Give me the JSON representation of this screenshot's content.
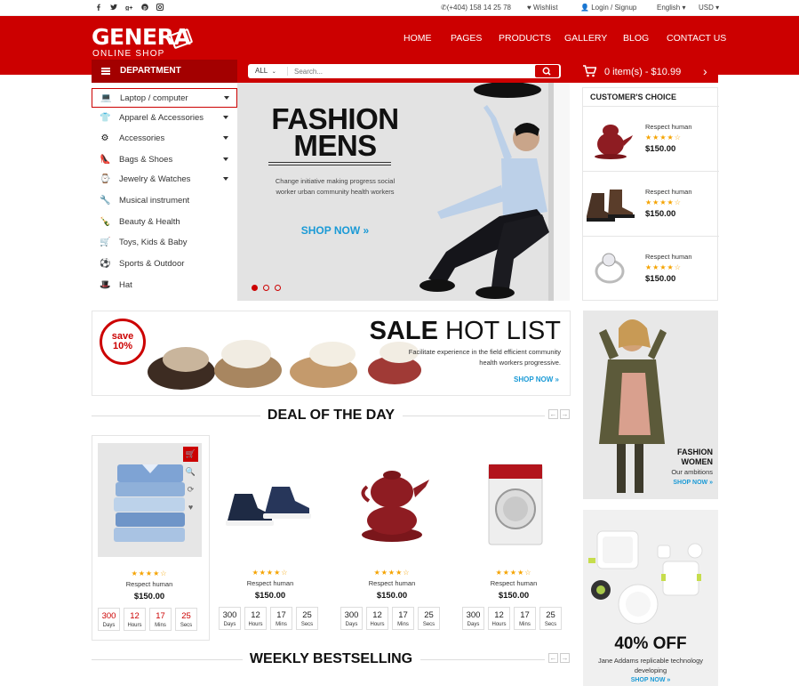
{
  "topbar": {
    "social": [
      "facebook-icon",
      "twitter-icon",
      "google-plus-icon",
      "pinterest-icon",
      "instagram-icon"
    ],
    "phone": "(+404) 158 14 25 78",
    "wishlist": "Wishlist",
    "login": "Login",
    "signup": "Signup",
    "language": "English",
    "currency": "USD"
  },
  "logo": {
    "main": "GENERA",
    "sub": "ONLINE SHOP"
  },
  "nav": [
    "HOME",
    "PAGES",
    "PRODUCTS",
    "GALLERY",
    "BLOG",
    "CONTACT US"
  ],
  "department": {
    "label": "DEPARTMENT",
    "items": [
      {
        "label": "Laptop / computer",
        "icon": "laptop-icon",
        "sub": true
      },
      {
        "label": "Apparel & Accessories",
        "icon": "tshirt-icon",
        "sub": true
      },
      {
        "label": "Accessories",
        "icon": "gear-icon",
        "sub": true
      },
      {
        "label": "Bags & Shoes",
        "icon": "shoe-icon",
        "sub": true
      },
      {
        "label": "Jewelry & Watches",
        "icon": "watch-icon",
        "sub": true
      },
      {
        "label": "Musical instrument",
        "icon": "wrench-icon",
        "sub": false
      },
      {
        "label": "Beauty & Health",
        "icon": "bottle-icon",
        "sub": false
      },
      {
        "label": "Toys, Kids & Baby",
        "icon": "stroller-icon",
        "sub": false
      },
      {
        "label": "Sports & Outdoor",
        "icon": "ball-icon",
        "sub": false
      },
      {
        "label": "Hat",
        "icon": "hat-icon",
        "sub": false
      }
    ]
  },
  "search": {
    "category": "ALL",
    "placeholder": "Search..."
  },
  "cart": {
    "summary": "0 item(s) - $10.99"
  },
  "hero": {
    "title_line1": "FASHION",
    "title_line2": "MENS",
    "description": "Change initiative making progress social worker urban community health workers",
    "cta": "SHOP NOW »",
    "slides": 3,
    "active_slide": 1
  },
  "customers_choice": {
    "title": "CUSTOMER'S CHOICE",
    "items": [
      {
        "name": "Respect human",
        "stars": "★★★★☆",
        "price": "$150.00"
      },
      {
        "name": "Respect human",
        "stars": "★★★★☆",
        "price": "$150.00"
      },
      {
        "name": "Respect human",
        "stars": "★★★★☆",
        "price": "$150.00"
      }
    ]
  },
  "sale": {
    "badge_line1": "save",
    "badge_line2": "10%",
    "title_bold": "SALE",
    "title_rest": " HOT LIST",
    "text": "Facilitate experience in the field efficient community health workers progressive.",
    "cta": "SHOP NOW »"
  },
  "fashion_women": {
    "line1": "FASHION",
    "line2": "WOMEN",
    "subtitle": "Our ambitions",
    "cta": "SHOP NOW »"
  },
  "promo": {
    "title": "40% OFF",
    "text": "Jane Addams replicable technology developing",
    "cta": "SHOP NOW »"
  },
  "deal": {
    "title": "DEAL OF THE DAY",
    "products": [
      {
        "name": "Respect human",
        "stars": "★★★★☆",
        "price": "$150.00",
        "countdown": [
          {
            "n": "300",
            "u": "Days"
          },
          {
            "n": "12",
            "u": "Hours"
          },
          {
            "n": "17",
            "u": "Mins"
          },
          {
            "n": "25",
            "u": "Secs"
          }
        ]
      },
      {
        "name": "Respect human",
        "stars": "★★★★☆",
        "price": "$150.00",
        "countdown": [
          {
            "n": "300",
            "u": "Days"
          },
          {
            "n": "12",
            "u": "Hours"
          },
          {
            "n": "17",
            "u": "Mins"
          },
          {
            "n": "25",
            "u": "Secs"
          }
        ]
      },
      {
        "name": "Respect human",
        "stars": "★★★★☆",
        "price": "$150.00",
        "countdown": [
          {
            "n": "300",
            "u": "Days"
          },
          {
            "n": "12",
            "u": "Hours"
          },
          {
            "n": "17",
            "u": "Mins"
          },
          {
            "n": "25",
            "u": "Secs"
          }
        ]
      },
      {
        "name": "Respect human",
        "stars": "★★★★☆",
        "price": "$150.00",
        "countdown": [
          {
            "n": "300",
            "u": "Days"
          },
          {
            "n": "12",
            "u": "Hours"
          },
          {
            "n": "17",
            "u": "Mins"
          },
          {
            "n": "25",
            "u": "Secs"
          }
        ]
      }
    ]
  },
  "weekly": {
    "title": "WEEKLY BESTSELLING"
  },
  "colors": {
    "brand": "#cc0000",
    "link": "#1a9ad6",
    "star": "#f5a300"
  }
}
